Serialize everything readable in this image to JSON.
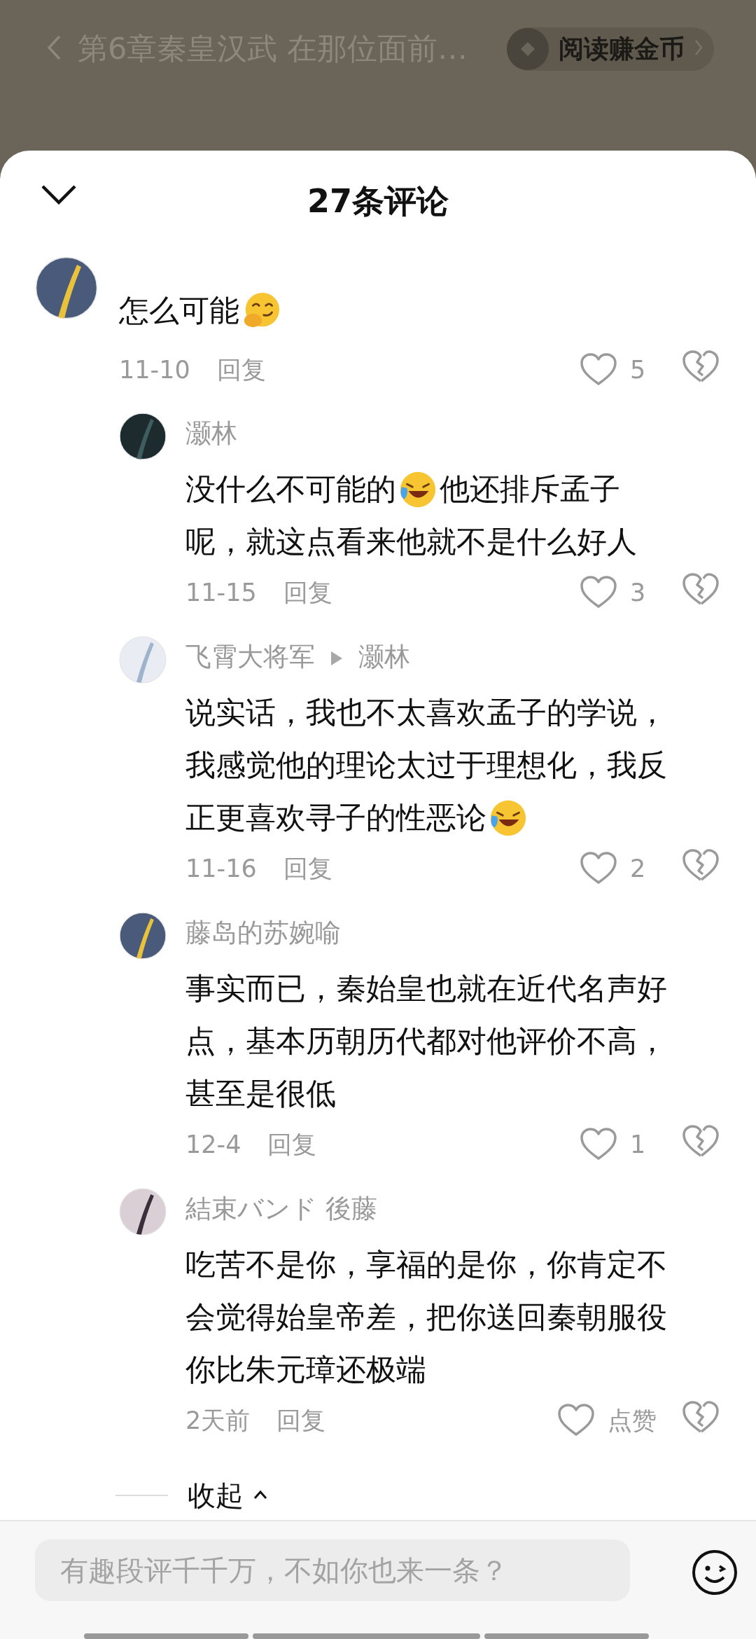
{
  "top_bar": {
    "chapter_title": "第6章秦皇汉武 在那位面前…",
    "coin_button": "阅读赚金币"
  },
  "sheet": {
    "title": "27条评论"
  },
  "comment": {
    "body": [
      [
        {
          "kind": "text",
          "text": "怎么可能"
        },
        {
          "kind": "shy"
        }
      ]
    ],
    "date": "11-10",
    "reply_label": "回复",
    "likes": "5",
    "replies": [
      {
        "name": "灏林",
        "body": [
          [
            {
              "kind": "text",
              "text": "没什么不可能的"
            },
            {
              "kind": "laughcry"
            },
            {
              "kind": "text",
              "text": "他还排斥孟子"
            }
          ],
          [
            {
              "kind": "text",
              "text": "呢，就这点看来他就不是什么好人"
            }
          ]
        ],
        "date": "11-15",
        "reply_label": "回复",
        "likes": "3"
      },
      {
        "name": "飞霄大将军",
        "reply_to": "灏林",
        "body": [
          [
            {
              "kind": "text",
              "text": "说实话，我也不太喜欢孟子的学说，"
            }
          ],
          [
            {
              "kind": "text",
              "text": "我感觉他的理论太过于理想化，我反"
            }
          ],
          [
            {
              "kind": "text",
              "text": "正更喜欢寻子的性恶论"
            },
            {
              "kind": "laughcry"
            }
          ]
        ],
        "date": "11-16",
        "reply_label": "回复",
        "likes": "2"
      },
      {
        "name": "藤岛的苏婉喻",
        "body": [
          [
            {
              "kind": "text",
              "text": "事实而已，秦始皇也就在近代名声好"
            }
          ],
          [
            {
              "kind": "text",
              "text": "点，基本历朝历代都对他评价不高，"
            }
          ],
          [
            {
              "kind": "text",
              "text": "甚至是很低"
            }
          ]
        ],
        "date": "12-4",
        "reply_label": "回复",
        "likes": "1"
      },
      {
        "name": "結束バンド 後藤",
        "body": [
          [
            {
              "kind": "text",
              "text": "吃苦不是你，享福的是你，你肯定不"
            }
          ],
          [
            {
              "kind": "text",
              "text": "会觉得始皇帝差，把你送回秦朝服役"
            }
          ],
          [
            {
              "kind": "text",
              "text": "你比朱元璋还极端"
            }
          ]
        ],
        "date": "2天前",
        "reply_label": "回复",
        "likes": "点赞"
      }
    ]
  },
  "collapse": {
    "label": "收起"
  },
  "input": {
    "placeholder": "有趣段评千千万，不如你也来一条？"
  }
}
